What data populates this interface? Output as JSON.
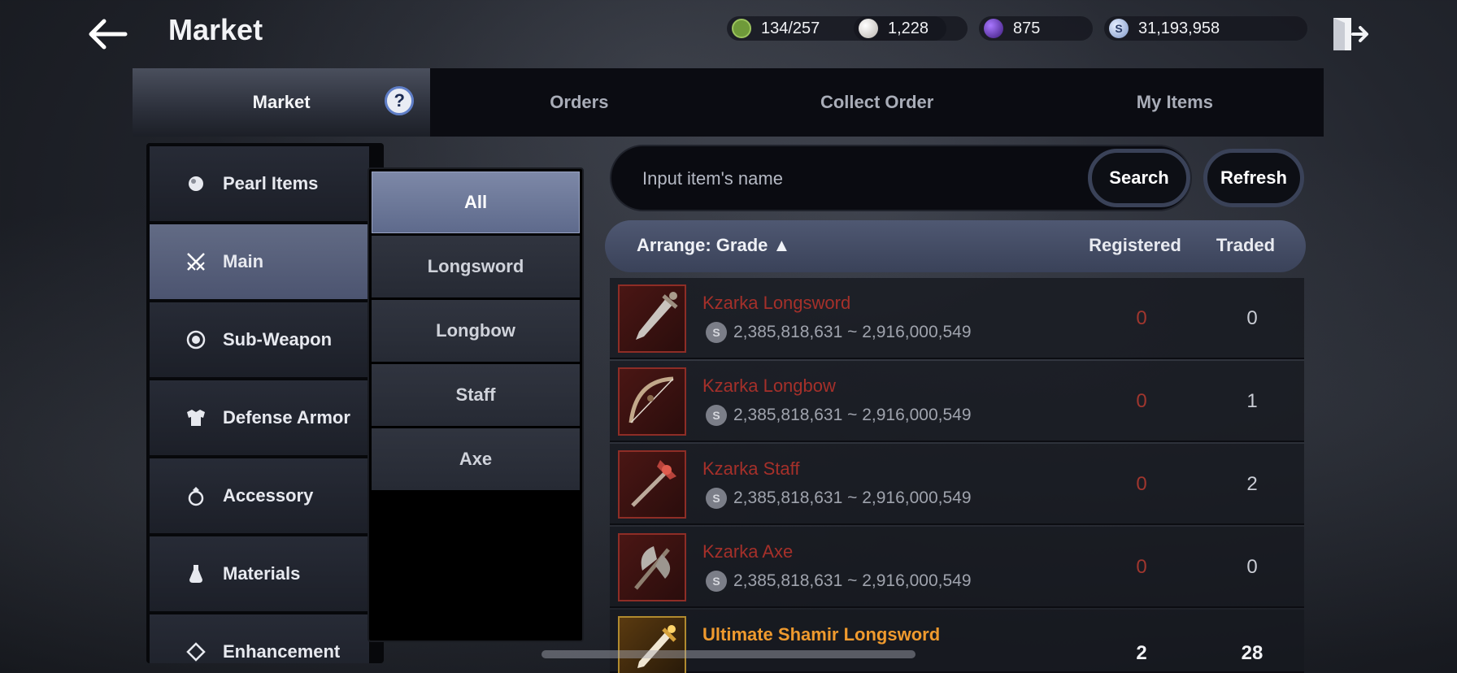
{
  "header": {
    "title": "Market"
  },
  "currencies": [
    {
      "icon": "energy-icon",
      "value": "134/257",
      "color": "#6f9a3a"
    },
    {
      "icon": "pearl-icon",
      "value": "1,228",
      "color": "#d8d4cf"
    },
    {
      "icon": "black-pearl-icon",
      "value": "875",
      "color": "#6a3ac0"
    },
    {
      "icon": "silver-icon",
      "value": "31,193,958",
      "color": "#9fb6e8"
    }
  ],
  "tabs": [
    {
      "label": "Market",
      "active": true
    },
    {
      "label": "Orders"
    },
    {
      "label": "Collect Order"
    },
    {
      "label": "My Items"
    }
  ],
  "help_label": "?",
  "categories": [
    {
      "label": "Pearl Items",
      "icon": "pearl-items-icon"
    },
    {
      "label": "Main",
      "icon": "crossed-swords-icon",
      "active": true
    },
    {
      "label": "Sub-Weapon",
      "icon": "sub-weapon-icon"
    },
    {
      "label": "Defense Armor",
      "icon": "armor-icon"
    },
    {
      "label": "Accessory",
      "icon": "ring-icon"
    },
    {
      "label": "Materials",
      "icon": "potion-icon"
    },
    {
      "label": "Enhancement",
      "icon": "enhancement-icon"
    }
  ],
  "subcategories": [
    {
      "label": "All",
      "active": true
    },
    {
      "label": "Longsword"
    },
    {
      "label": "Longbow"
    },
    {
      "label": "Staff"
    },
    {
      "label": "Axe"
    }
  ],
  "search": {
    "placeholder": "Input item's name",
    "button": "Search",
    "refresh": "Refresh"
  },
  "list_header": {
    "arrange": "Arrange: Grade ▲",
    "registered": "Registered",
    "traded": "Traded"
  },
  "items": [
    {
      "name": "Kzarka Longsword",
      "price_range": "2,385,818,631 ~ 2,916,000,549",
      "registered": "0",
      "traded": "0",
      "icon": "longsword-icon"
    },
    {
      "name": "Kzarka Longbow",
      "price_range": "2,385,818,631 ~ 2,916,000,549",
      "registered": "0",
      "traded": "1",
      "icon": "longbow-icon"
    },
    {
      "name": "Kzarka Staff",
      "price_range": "2,385,818,631 ~ 2,916,000,549",
      "registered": "0",
      "traded": "2",
      "icon": "staff-icon"
    },
    {
      "name": "Kzarka Axe",
      "price_range": "2,385,818,631 ~ 2,916,000,549",
      "registered": "0",
      "traded": "0",
      "icon": "axe-icon"
    },
    {
      "name": "Ultimate Shamir Longsword",
      "price_range": "",
      "registered": "2",
      "traded": "28",
      "icon": "longsword-icon"
    }
  ],
  "coin_symbol": "S"
}
